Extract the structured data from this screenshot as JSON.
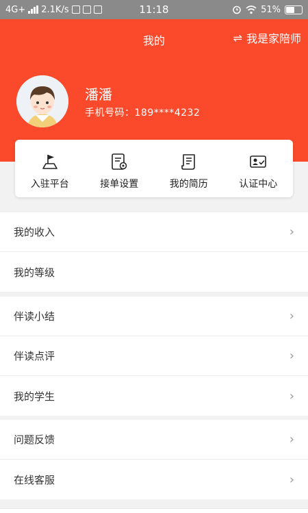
{
  "status_bar": {
    "network": "4G+",
    "speed": "2.1K/s",
    "time": "11:18",
    "battery": "51%"
  },
  "header": {
    "title": "我的",
    "switch_role_label": "我是家陪师",
    "bg_color": "#fb4a2b"
  },
  "profile": {
    "name": "潘潘",
    "phone": "手机号码：189****4232"
  },
  "quick_actions": [
    {
      "label": "入驻平台",
      "icon": "flag-icon"
    },
    {
      "label": "接单设置",
      "icon": "order-settings-icon"
    },
    {
      "label": "我的简历",
      "icon": "resume-icon"
    },
    {
      "label": "认证中心",
      "icon": "id-card-check-icon"
    }
  ],
  "menu_groups": [
    [
      {
        "label": "我的收入",
        "chevron": true
      },
      {
        "label": "我的等级",
        "chevron": false
      }
    ],
    [
      {
        "label": "伴读小结",
        "chevron": true
      },
      {
        "label": "伴读点评",
        "chevron": true
      },
      {
        "label": "我的学生",
        "chevron": true
      }
    ],
    [
      {
        "label": "问题反馈",
        "chevron": true
      },
      {
        "label": "在线客服",
        "chevron": true
      }
    ]
  ]
}
